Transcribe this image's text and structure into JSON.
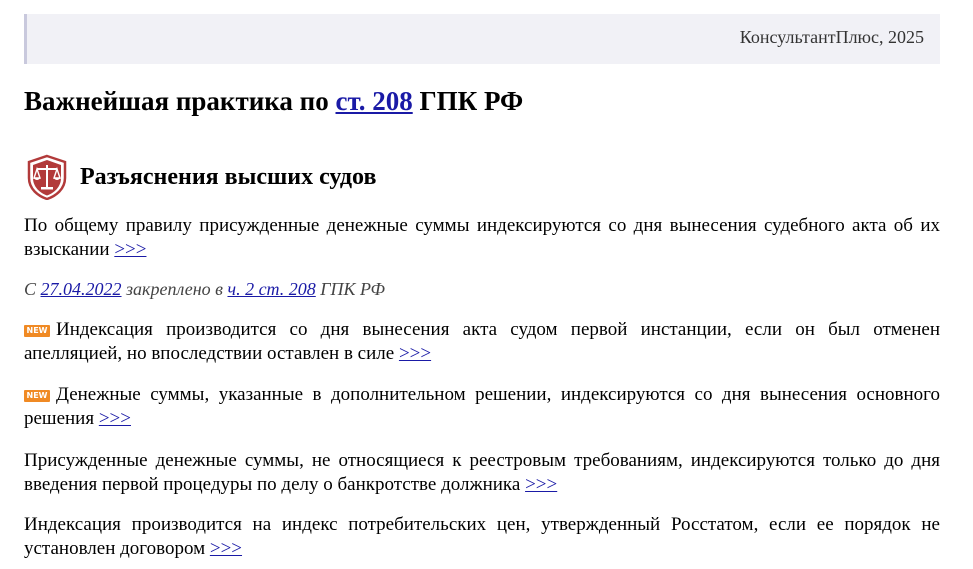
{
  "header": {
    "copyright": "КонсультантПлюс, 2025"
  },
  "title": {
    "prefix": "Важнейшая практика по ",
    "link": "ст. 208",
    "suffix": " ГПК РФ"
  },
  "section": {
    "icon": "court-scales-icon",
    "title": "Разъяснения высших судов"
  },
  "paragraphs": [
    {
      "text": "По общему правилу присужденные денежные суммы индексируются со дня вынесения судебного акта об их взыскании ",
      "more": ">>>"
    }
  ],
  "fixed_note": {
    "prefix": "С ",
    "date": "27.04.2022",
    "middle": " закреплено в ",
    "link": "ч. 2 ст. 208",
    "suffix": " ГПК РФ"
  },
  "items": [
    {
      "badge": "NEW",
      "text": "Индексация производится со дня вынесения акта судом первой инстанции, если он был отменен апелляцией, но впоследствии оставлен в силе ",
      "more": ">>>"
    },
    {
      "badge": "NEW",
      "text": "Денежные суммы, указанные в дополнительном решении, индексируются со дня вынесения основного решения ",
      "more": ">>>"
    },
    {
      "text": "Присужденные денежные суммы, не относящиеся к реестровым требованиям, индексируются только до дня введения первой процедуры по делу о банкротстве должника ",
      "more": ">>>"
    },
    {
      "text": "Индексация производится на индекс потребительских цен, утвержденный Росстатом, если ее порядок не установлен договором ",
      "more": ">>>"
    }
  ],
  "colors": {
    "link": "#1a1aa6",
    "badge": "#f08a24",
    "icon": "#b23a3a",
    "header_bg": "#f1f1f6"
  }
}
